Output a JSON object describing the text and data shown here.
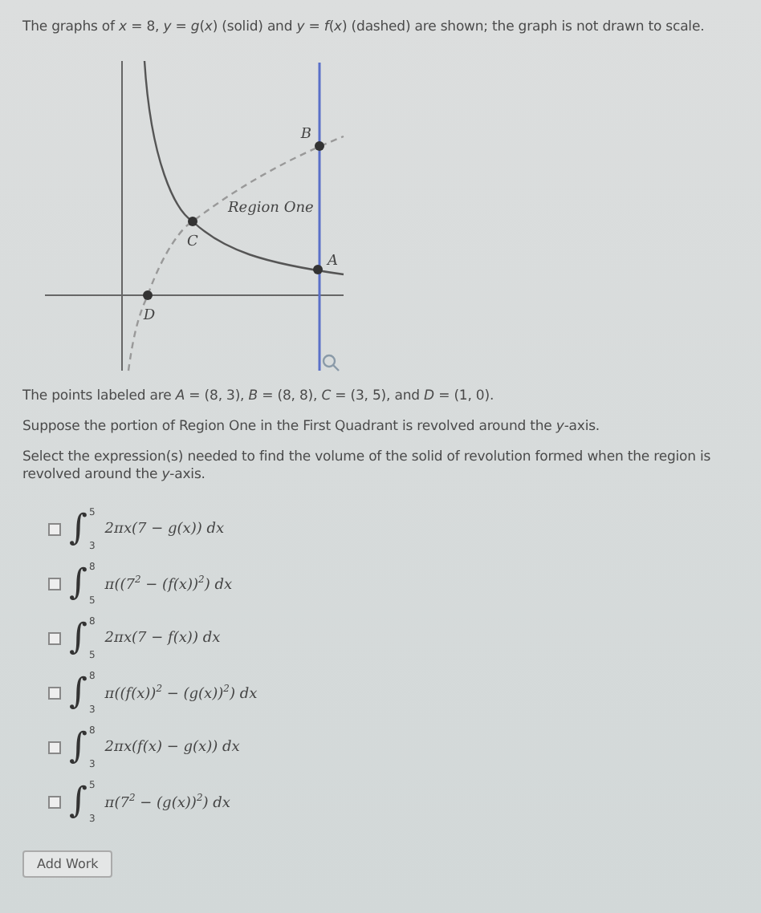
{
  "intro": "The graphs of *x* = 8, *y* = *g*(*x*) (solid) and *y* = *f*(*x*) (dashed) are shown; the graph is not drawn to scale.",
  "graph": {
    "labels": [
      "B",
      "Region One",
      "C",
      "A",
      "D"
    ]
  },
  "points_text": "The points labeled are *A* = (8, 3), *B* = (8, 8), *C* = (3, 5), and *D* = (1, 0).",
  "setup_text": "Suppose the portion of Region One in the First Quadrant is revolved around the *y*-axis.",
  "question": "Select the expression(s) needed to find the volume of the solid of revolution formed when the region is revolved around the *y*-axis.",
  "options": [
    {
      "checked": false,
      "sign": "∫",
      "upper": "5",
      "lower": "3",
      "integrand": "2πx(7 − g(x)) dx"
    },
    {
      "checked": false,
      "sign": "∫",
      "upper": "8",
      "lower": "5",
      "integrand": "π((7$^{2}$ − (f(x))$^{2}$) dx"
    },
    {
      "checked": false,
      "sign": "∫",
      "upper": "8",
      "lower": "5",
      "integrand": "2πx(7 − f(x)) dx"
    },
    {
      "checked": false,
      "sign": "∫",
      "upper": "8",
      "lower": "3",
      "integrand": "π((f(x))$^{2}$ − (g(x))$^{2}$) dx"
    },
    {
      "checked": false,
      "sign": "∫",
      "upper": "8",
      "lower": "3",
      "integrand": "2πx(f(x) − g(x)) dx"
    },
    {
      "checked": false,
      "sign": "∫",
      "upper": "5",
      "lower": "3",
      "integrand": "π(7$^{2}$ − (g(x))$^{2}$) dx"
    }
  ],
  "button": "Add Work"
}
